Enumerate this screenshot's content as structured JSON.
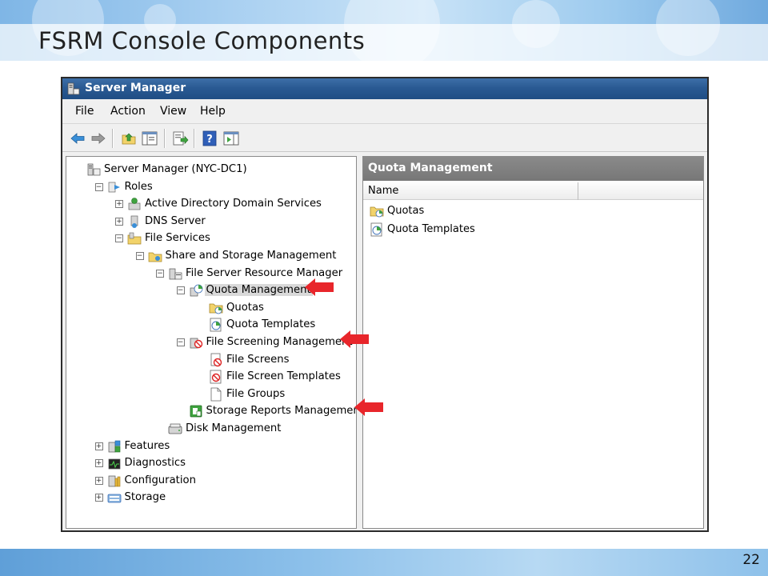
{
  "slide": {
    "title": "FSRM Console Components",
    "number": "22"
  },
  "window": {
    "title": "Server Manager",
    "menu": [
      "File",
      "Action",
      "View",
      "Help"
    ],
    "toolbar_icons": [
      "back-arrow-icon",
      "forward-arrow-icon",
      "up-folder-icon",
      "show-hide-tree-icon",
      "export-list-icon",
      "help-icon",
      "show-action-pane-icon"
    ]
  },
  "tree": [
    {
      "label": "Server Manager (NYC-DC1)",
      "icon": "server-manager-icon",
      "expander": ""
    },
    {
      "label": "Roles",
      "icon": "roles-icon",
      "expander": "−"
    },
    {
      "label": "Active Directory Domain Services",
      "icon": "ad-ds-icon",
      "expander": "+"
    },
    {
      "label": "DNS Server",
      "icon": "dns-server-icon",
      "expander": "+"
    },
    {
      "label": "File Services",
      "icon": "file-services-icon",
      "expander": "−"
    },
    {
      "label": "Share and Storage Management",
      "icon": "share-storage-icon",
      "expander": "−"
    },
    {
      "label": "File Server Resource Manager",
      "icon": "fsrm-icon",
      "expander": "−"
    },
    {
      "label": "Quota Management",
      "icon": "quota-management-icon",
      "expander": "−",
      "selected": true
    },
    {
      "label": "Quotas",
      "icon": "quotas-folder-icon",
      "expander": ""
    },
    {
      "label": "Quota Templates",
      "icon": "quota-templates-icon",
      "expander": ""
    },
    {
      "label": "File Screening Management",
      "icon": "file-screening-icon",
      "expander": "−"
    },
    {
      "label": "File Screens",
      "icon": "file-screens-icon",
      "expander": ""
    },
    {
      "label": "File Screen Templates",
      "icon": "file-screen-templates-icon",
      "expander": ""
    },
    {
      "label": "File Groups",
      "icon": "file-groups-icon",
      "expander": ""
    },
    {
      "label": "Storage Reports Management",
      "icon": "storage-reports-icon",
      "expander": ""
    },
    {
      "label": "Disk Management",
      "icon": "disk-management-icon",
      "expander": ""
    },
    {
      "label": "Features",
      "icon": "features-icon",
      "expander": "+"
    },
    {
      "label": "Diagnostics",
      "icon": "diagnostics-icon",
      "expander": "+"
    },
    {
      "label": "Configuration",
      "icon": "configuration-icon",
      "expander": "+"
    },
    {
      "label": "Storage",
      "icon": "storage-icon",
      "expander": "+"
    }
  ],
  "result_pane": {
    "title": "Quota Management",
    "column": "Name",
    "items": [
      {
        "label": "Quotas",
        "icon": "quotas-folder-icon"
      },
      {
        "label": "Quota Templates",
        "icon": "quota-templates-icon"
      }
    ]
  },
  "colors": {
    "title_bar": "#2a5a93",
    "highlight_arrow": "#e8262b",
    "selection": "#d9d9d9"
  }
}
